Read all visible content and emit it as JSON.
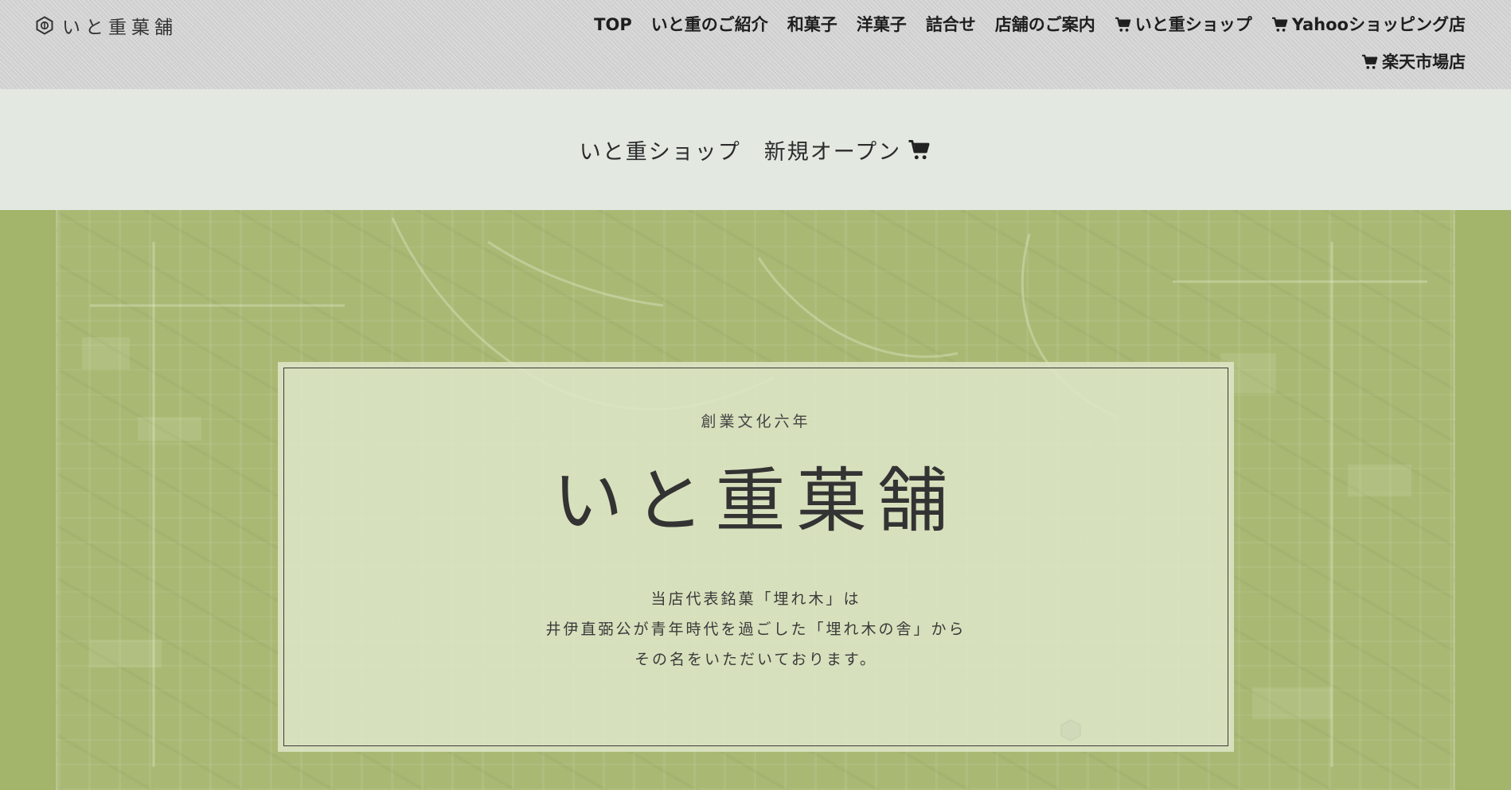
{
  "site": {
    "logo_text": "いと重菓舗"
  },
  "nav": {
    "items": [
      {
        "label": "TOP",
        "cart": false
      },
      {
        "label": "いと重のご紹介",
        "cart": false
      },
      {
        "label": "和菓子",
        "cart": false
      },
      {
        "label": "洋菓子",
        "cart": false
      },
      {
        "label": "詰合せ",
        "cart": false
      },
      {
        "label": "店舗のご案内",
        "cart": false
      },
      {
        "label": "いと重ショップ",
        "cart": true
      },
      {
        "label": "Yahooショッピング店",
        "cart": true
      },
      {
        "label": "楽天市場店",
        "cart": true
      }
    ]
  },
  "announcement": {
    "text": "いと重ショップ　新規オープン"
  },
  "hero": {
    "since": "創業文化六年",
    "title": "いと重菓舗",
    "description": [
      "当店代表銘菓「埋れ木」は",
      "井伊直弼公が青年時代を過ごした「埋れ木の舎」から",
      "その名をいただいております。"
    ]
  },
  "colors": {
    "header_bg": "#d9d9da",
    "announce_bg": "#e3e8e1",
    "hero_bg": "#a3b46b",
    "card_bg": "#dee7c8",
    "text": "#2b2b2b"
  },
  "icons": {
    "logo": "hexagon-crest-icon",
    "cart": "cart-icon"
  }
}
